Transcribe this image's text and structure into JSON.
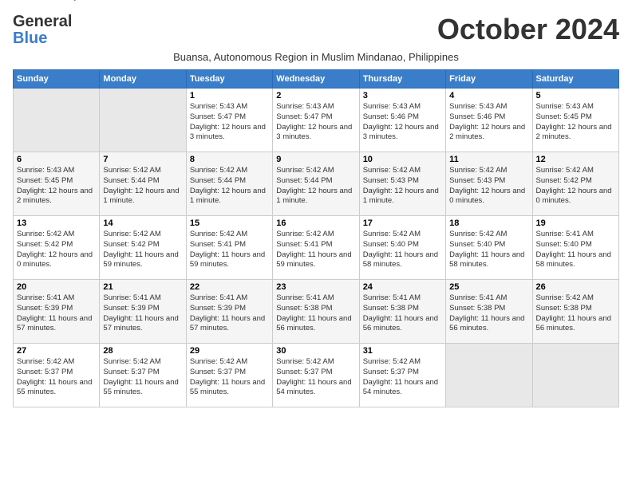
{
  "logo": {
    "line1": "General",
    "line2": "Blue"
  },
  "title": "October 2024",
  "subtitle": "Buansa, Autonomous Region in Muslim Mindanao, Philippines",
  "days_of_week": [
    "Sunday",
    "Monday",
    "Tuesday",
    "Wednesday",
    "Thursday",
    "Friday",
    "Saturday"
  ],
  "weeks": [
    [
      {
        "day": "",
        "info": ""
      },
      {
        "day": "",
        "info": ""
      },
      {
        "day": "1",
        "info": "Sunrise: 5:43 AM\nSunset: 5:47 PM\nDaylight: 12 hours and 3 minutes."
      },
      {
        "day": "2",
        "info": "Sunrise: 5:43 AM\nSunset: 5:47 PM\nDaylight: 12 hours and 3 minutes."
      },
      {
        "day": "3",
        "info": "Sunrise: 5:43 AM\nSunset: 5:46 PM\nDaylight: 12 hours and 3 minutes."
      },
      {
        "day": "4",
        "info": "Sunrise: 5:43 AM\nSunset: 5:46 PM\nDaylight: 12 hours and 2 minutes."
      },
      {
        "day": "5",
        "info": "Sunrise: 5:43 AM\nSunset: 5:45 PM\nDaylight: 12 hours and 2 minutes."
      }
    ],
    [
      {
        "day": "6",
        "info": "Sunrise: 5:43 AM\nSunset: 5:45 PM\nDaylight: 12 hours and 2 minutes."
      },
      {
        "day": "7",
        "info": "Sunrise: 5:42 AM\nSunset: 5:44 PM\nDaylight: 12 hours and 1 minute."
      },
      {
        "day": "8",
        "info": "Sunrise: 5:42 AM\nSunset: 5:44 PM\nDaylight: 12 hours and 1 minute."
      },
      {
        "day": "9",
        "info": "Sunrise: 5:42 AM\nSunset: 5:44 PM\nDaylight: 12 hours and 1 minute."
      },
      {
        "day": "10",
        "info": "Sunrise: 5:42 AM\nSunset: 5:43 PM\nDaylight: 12 hours and 1 minute."
      },
      {
        "day": "11",
        "info": "Sunrise: 5:42 AM\nSunset: 5:43 PM\nDaylight: 12 hours and 0 minutes."
      },
      {
        "day": "12",
        "info": "Sunrise: 5:42 AM\nSunset: 5:42 PM\nDaylight: 12 hours and 0 minutes."
      }
    ],
    [
      {
        "day": "13",
        "info": "Sunrise: 5:42 AM\nSunset: 5:42 PM\nDaylight: 12 hours and 0 minutes."
      },
      {
        "day": "14",
        "info": "Sunrise: 5:42 AM\nSunset: 5:42 PM\nDaylight: 11 hours and 59 minutes."
      },
      {
        "day": "15",
        "info": "Sunrise: 5:42 AM\nSunset: 5:41 PM\nDaylight: 11 hours and 59 minutes."
      },
      {
        "day": "16",
        "info": "Sunrise: 5:42 AM\nSunset: 5:41 PM\nDaylight: 11 hours and 59 minutes."
      },
      {
        "day": "17",
        "info": "Sunrise: 5:42 AM\nSunset: 5:40 PM\nDaylight: 11 hours and 58 minutes."
      },
      {
        "day": "18",
        "info": "Sunrise: 5:42 AM\nSunset: 5:40 PM\nDaylight: 11 hours and 58 minutes."
      },
      {
        "day": "19",
        "info": "Sunrise: 5:41 AM\nSunset: 5:40 PM\nDaylight: 11 hours and 58 minutes."
      }
    ],
    [
      {
        "day": "20",
        "info": "Sunrise: 5:41 AM\nSunset: 5:39 PM\nDaylight: 11 hours and 57 minutes."
      },
      {
        "day": "21",
        "info": "Sunrise: 5:41 AM\nSunset: 5:39 PM\nDaylight: 11 hours and 57 minutes."
      },
      {
        "day": "22",
        "info": "Sunrise: 5:41 AM\nSunset: 5:39 PM\nDaylight: 11 hours and 57 minutes."
      },
      {
        "day": "23",
        "info": "Sunrise: 5:41 AM\nSunset: 5:38 PM\nDaylight: 11 hours and 56 minutes."
      },
      {
        "day": "24",
        "info": "Sunrise: 5:41 AM\nSunset: 5:38 PM\nDaylight: 11 hours and 56 minutes."
      },
      {
        "day": "25",
        "info": "Sunrise: 5:41 AM\nSunset: 5:38 PM\nDaylight: 11 hours and 56 minutes."
      },
      {
        "day": "26",
        "info": "Sunrise: 5:42 AM\nSunset: 5:38 PM\nDaylight: 11 hours and 56 minutes."
      }
    ],
    [
      {
        "day": "27",
        "info": "Sunrise: 5:42 AM\nSunset: 5:37 PM\nDaylight: 11 hours and 55 minutes."
      },
      {
        "day": "28",
        "info": "Sunrise: 5:42 AM\nSunset: 5:37 PM\nDaylight: 11 hours and 55 minutes."
      },
      {
        "day": "29",
        "info": "Sunrise: 5:42 AM\nSunset: 5:37 PM\nDaylight: 11 hours and 55 minutes."
      },
      {
        "day": "30",
        "info": "Sunrise: 5:42 AM\nSunset: 5:37 PM\nDaylight: 11 hours and 54 minutes."
      },
      {
        "day": "31",
        "info": "Sunrise: 5:42 AM\nSunset: 5:37 PM\nDaylight: 11 hours and 54 minutes."
      },
      {
        "day": "",
        "info": ""
      },
      {
        "day": "",
        "info": ""
      }
    ]
  ]
}
